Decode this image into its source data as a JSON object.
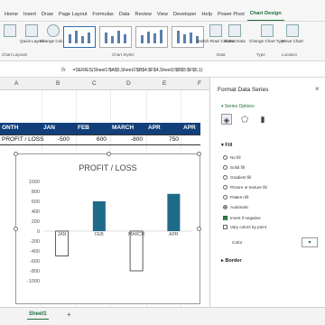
{
  "ribbon": {
    "tabs": [
      "Home",
      "Insert",
      "Draw",
      "Page Layout",
      "Formulas",
      "Data",
      "Review",
      "View",
      "Developer",
      "Help",
      "Power Pivot",
      "Chart Design"
    ],
    "active_tab": "Chart Design",
    "buttons": {
      "add_element": "Chart Layouts",
      "quick_layout": "Quick Layout",
      "change_colors": "Change Colors",
      "switch_row_col": "Switch Row/ Column",
      "select_data": "Select Data",
      "change_type": "Change Chart Type",
      "move_chart": "Move Chart"
    },
    "group_labels": {
      "chart_layouts": "Chart Layouts",
      "chart_styles": "Chart Styles",
      "data": "Data",
      "type": "Type",
      "location": "Location"
    }
  },
  "formula_bar": {
    "fx": "fx",
    "formula": "=SERIES(Sheet1!$A$5,Sheet1!$B$4:$F$4,Sheet1!$B$5:$F$5,1)"
  },
  "sheet": {
    "columns": [
      "A",
      "B",
      "C",
      "D",
      "E",
      "F"
    ],
    "header_row": [
      "ONTH",
      "JAN",
      "FEB",
      "MARCH",
      "APR",
      "APR"
    ],
    "data_row": [
      "PROFIT / LOSS",
      "-500",
      "600",
      "-800",
      "750",
      ""
    ],
    "tab_name": "Sheet1",
    "add_sheet": "+"
  },
  "chart_data": {
    "type": "bar",
    "title": "PROFIT / LOSS",
    "categories": [
      "JAN",
      "FEB",
      "MARCH",
      "APR"
    ],
    "values": [
      -500,
      600,
      -800,
      750
    ],
    "yticks": [
      1000,
      800,
      600,
      400,
      200,
      0,
      -200,
      -400,
      -600,
      -800,
      -1000
    ],
    "ylim": [
      -1000,
      1000
    ],
    "positive_color": "#1f6b8a",
    "negative_fill": "#ffffff",
    "negative_outline": "#333333",
    "invert_if_negative": true,
    "grid": false
  },
  "format_panel": {
    "title": "Format Data Series",
    "close": "×",
    "series_options": "Series Options",
    "fill_heading": "Fill",
    "fill_options": [
      {
        "label": "No fill",
        "checked": false
      },
      {
        "label": "Solid fill",
        "checked": false
      },
      {
        "label": "Gradient fill",
        "checked": false
      },
      {
        "label": "Picture or texture fill",
        "checked": false
      },
      {
        "label": "Pattern fill",
        "checked": false
      },
      {
        "label": "Automatic",
        "checked": true
      }
    ],
    "invert_label": "Invert if negative",
    "vary_label": "Vary colors by point",
    "color_label": "Color",
    "border_heading": "Border"
  }
}
